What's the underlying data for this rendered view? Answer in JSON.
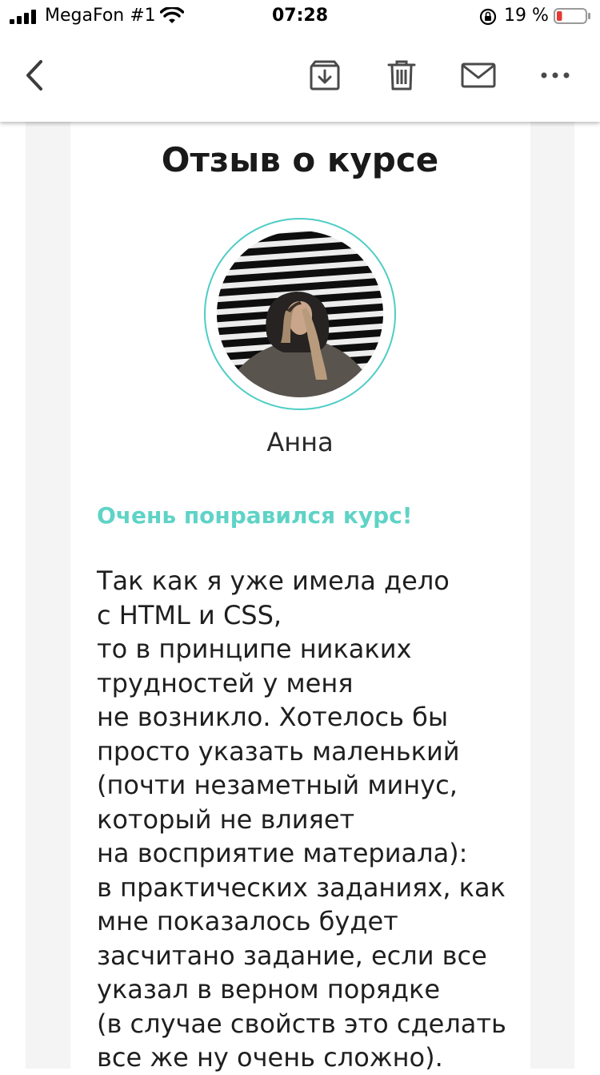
{
  "status_bar": {
    "carrier": "MegaFon #1",
    "time": "07:28",
    "battery_percent": "19 %",
    "battery_level": 0.19,
    "battery_color": "#e53935"
  },
  "toolbar": {
    "back_icon": "chevron-left-icon",
    "archive_icon": "archive-icon",
    "delete_icon": "trash-icon",
    "mail_icon": "envelope-icon",
    "more_icon": "more-horizontal-icon"
  },
  "email": {
    "title": "Отзыв о курсе",
    "author": "Анна",
    "subtitle": "Очень понравился курс!",
    "accent_color": "#5fd3c6",
    "body_lines": [
      "Так как я уже имела дело",
      "с HTML и CSS,",
      "то в принципе никаких",
      "трудностей у меня",
      "не возникло. Хотелось бы",
      "просто указать маленький",
      "(почти незаметный минус,",
      "который не влияет",
      "на восприятие материала):",
      "в практических заданиях, как",
      "мне показалось будет",
      "засчитано задание, если все",
      "указал в верном порядке",
      "(в случае свойств это сделать",
      "все же ну очень сложно)."
    ]
  }
}
